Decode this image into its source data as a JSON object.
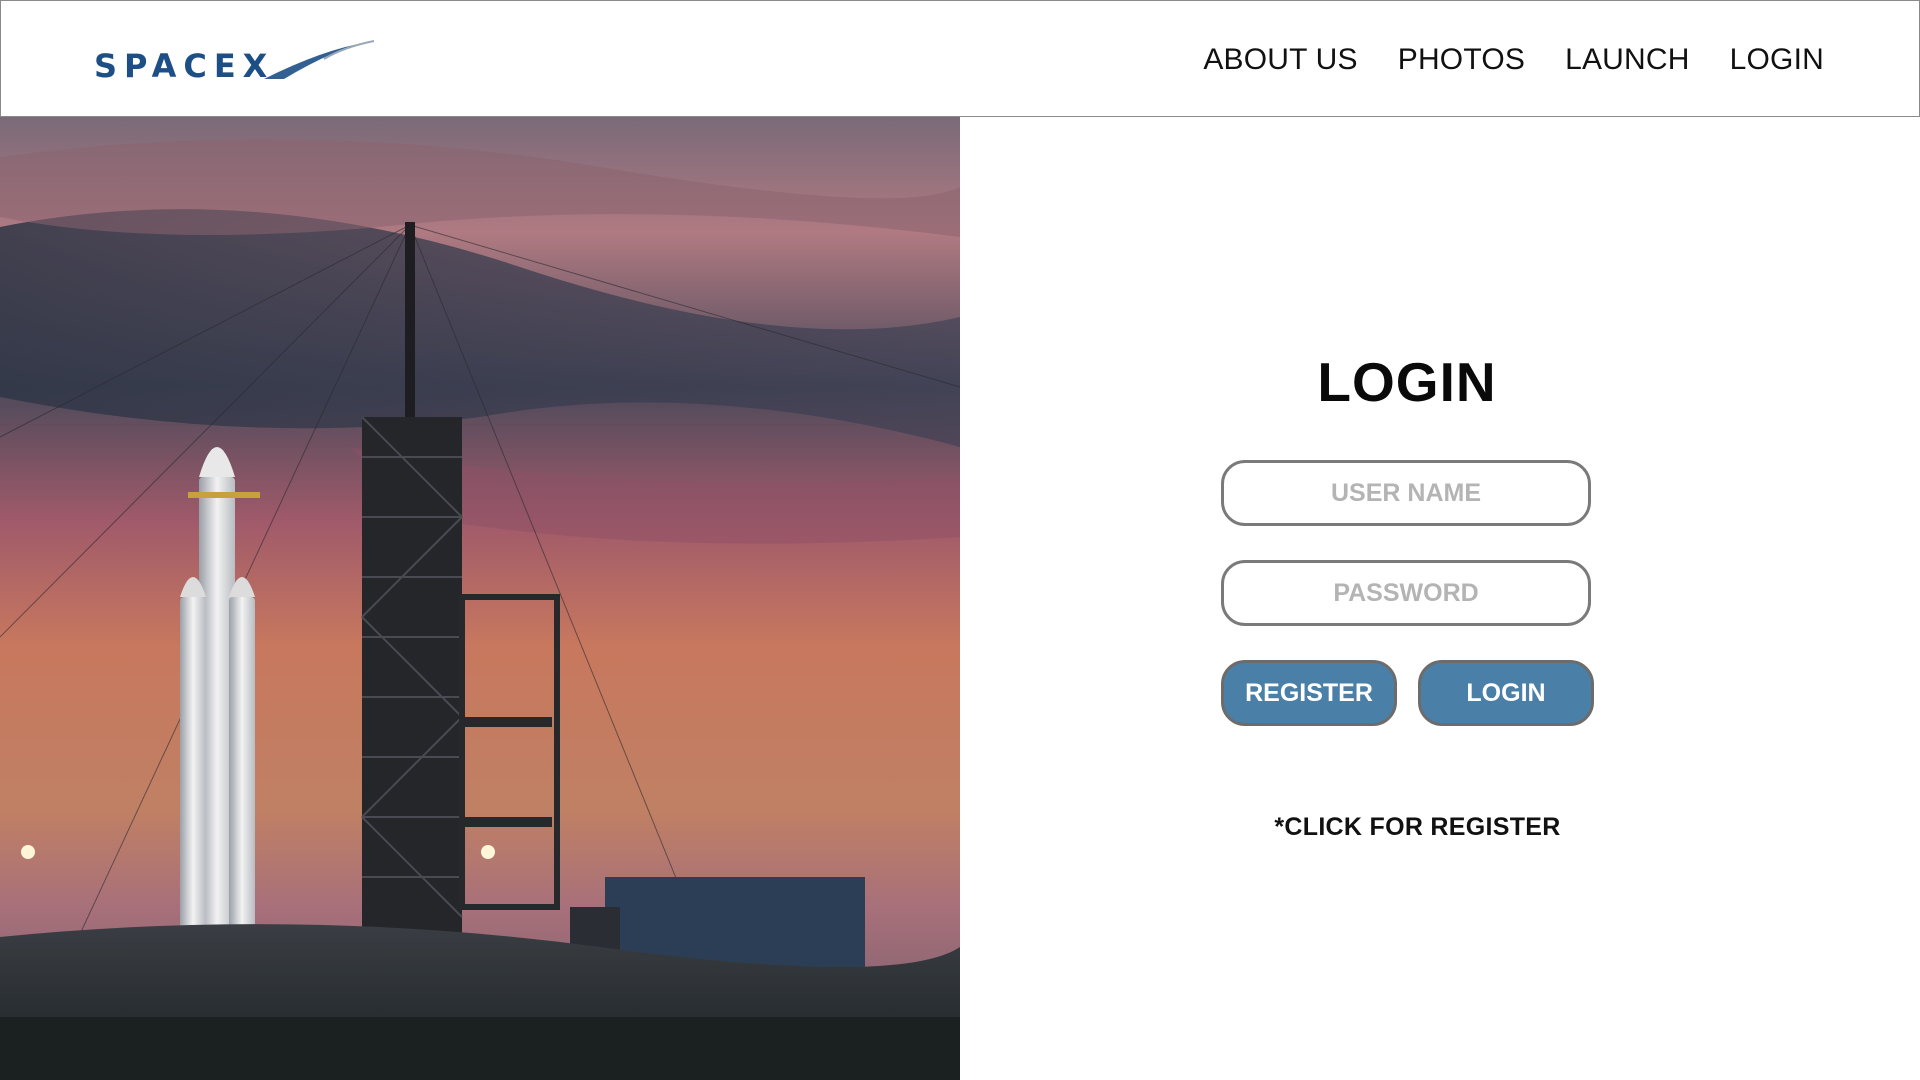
{
  "brand": {
    "logo_text": "SPACEX",
    "logo_color": "#1d4f86"
  },
  "nav": {
    "items": [
      "ABOUT US",
      "PHOTOS",
      "LAUNCH",
      "LOGIN"
    ]
  },
  "hero": {
    "image_icon": "rocket-launchpad-photo"
  },
  "login": {
    "title": "LOGIN",
    "username_placeholder": "USER NAME",
    "password_placeholder": "PASSWORD",
    "register_label": "REGISTER",
    "login_label": "LOGIN",
    "hint": "*CLICK FOR REGISTER"
  },
  "colors": {
    "button_blue": "#4a80a8",
    "field_border": "#7a7a7a",
    "placeholder": "#b4b4b4"
  }
}
